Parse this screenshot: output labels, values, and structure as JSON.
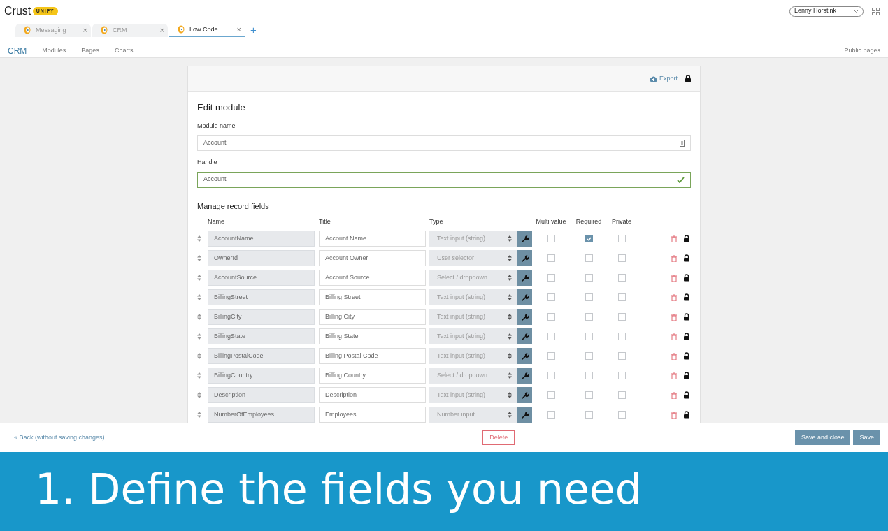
{
  "brand": {
    "name": "Crust",
    "badge": "UNIFY"
  },
  "user_menu": {
    "value": "Lenny Horstink"
  },
  "tabs": [
    {
      "label": "Messaging",
      "close": "×",
      "selected": false
    },
    {
      "label": "CRM",
      "close": "×",
      "selected": false
    },
    {
      "label": "Low Code",
      "close": "×",
      "selected": true
    }
  ],
  "add_tab": "+",
  "nav": {
    "title": "CRM",
    "items": [
      "Modules",
      "Pages",
      "Charts"
    ],
    "right_link": "Public pages"
  },
  "card": {
    "export": "Export",
    "title": "Edit module",
    "module_name": {
      "label": "Module name",
      "value": "Account"
    },
    "handle": {
      "label": "Handle",
      "value": "Account",
      "valid": true
    },
    "section_title": "Manage record fields",
    "columns": [
      "Name",
      "Title",
      "Type",
      "Multi value",
      "Required",
      "Private"
    ],
    "fields": [
      {
        "name": "AccountName",
        "title": "Account Name",
        "type": "Text input (string)",
        "multi": false,
        "required": true,
        "private": false
      },
      {
        "name": "OwnerId",
        "title": "Account Owner",
        "type": "User selector",
        "multi": false,
        "required": false,
        "private": false
      },
      {
        "name": "AccountSource",
        "title": "Account Source",
        "type": "Select / dropdown",
        "multi": false,
        "required": false,
        "private": false
      },
      {
        "name": "BillingStreet",
        "title": "Billing Street",
        "type": "Text input (string)",
        "multi": false,
        "required": false,
        "private": false
      },
      {
        "name": "BillingCity",
        "title": "Billing City",
        "type": "Text input (string)",
        "multi": false,
        "required": false,
        "private": false
      },
      {
        "name": "BillingState",
        "title": "Billing State",
        "type": "Text input (string)",
        "multi": false,
        "required": false,
        "private": false
      },
      {
        "name": "BillingPostalCode",
        "title": "Billing Postal Code",
        "type": "Text input (string)",
        "multi": false,
        "required": false,
        "private": false
      },
      {
        "name": "BillingCountry",
        "title": "Billing Country",
        "type": "Select / dropdown",
        "multi": false,
        "required": false,
        "private": false
      },
      {
        "name": "Description",
        "title": "Description",
        "type": "Text input (string)",
        "multi": false,
        "required": false,
        "private": false
      },
      {
        "name": "NumberOfEmployees",
        "title": "Employees",
        "type": "Number input",
        "multi": false,
        "required": false,
        "private": false
      }
    ]
  },
  "footer": {
    "back": "« Back (without saving changes)",
    "delete": "Delete",
    "save_close": "Save and close",
    "save": "Save"
  },
  "banner": "1. Define the fields you need"
}
